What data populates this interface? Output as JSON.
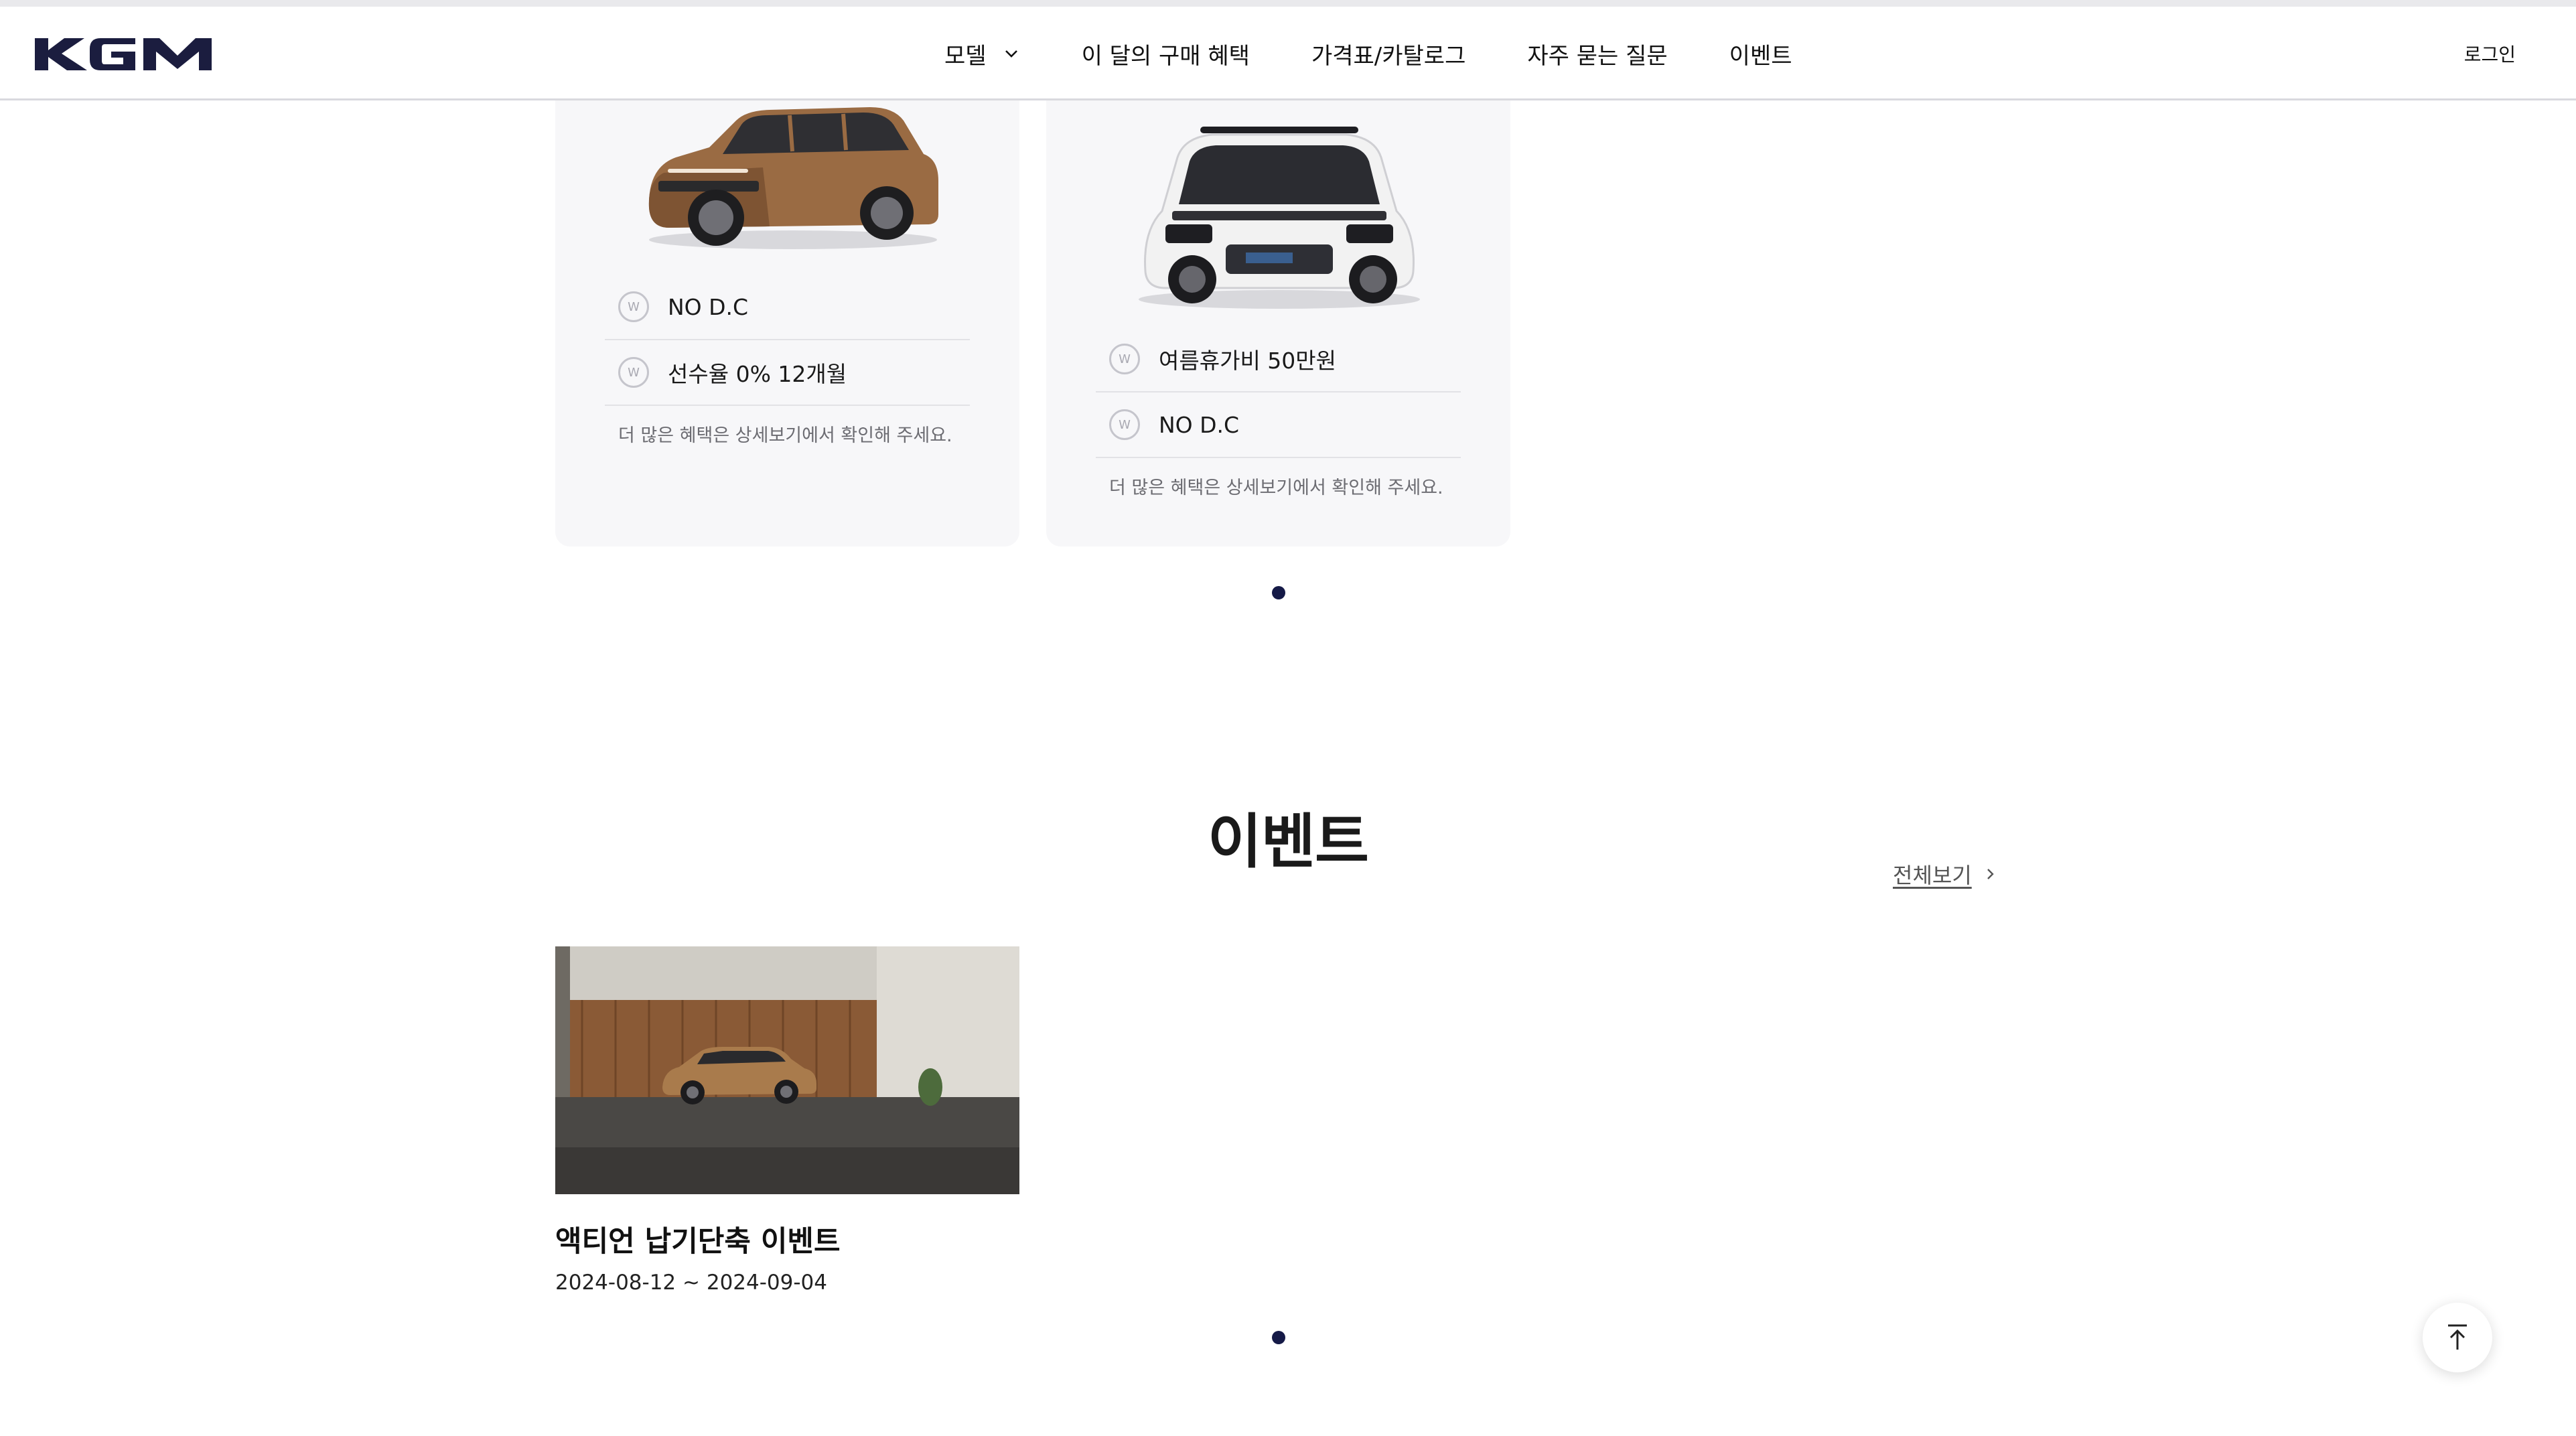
{
  "header": {
    "logo_text": "KGM",
    "nav": [
      {
        "label": "모델"
      },
      {
        "label": "이 달의 구매 혜택"
      },
      {
        "label": "가격표/카탈로그"
      },
      {
        "label": "자주 묻는 질문"
      },
      {
        "label": "이벤트"
      }
    ],
    "login_label": "로그인"
  },
  "models": [
    {
      "car_color": "bronze",
      "benefits": [
        "NO D.C",
        "선수율 0% 12개월"
      ],
      "note": "더 많은 혜택은 상세보기에서 확인해 주세요."
    },
    {
      "car_color": "white",
      "benefits": [
        "여름휴가비 50만원",
        "NO D.C"
      ],
      "note": "더 많은 혜택은 상세보기에서 확인해 주세요."
    }
  ],
  "events": {
    "title": "이벤트",
    "view_all": "전체보기",
    "items": [
      {
        "title": "액티언 납기단축 이벤트",
        "date": "2024-08-12 ~ 2024-09-04"
      }
    ]
  },
  "icons": {
    "won": "won-icon",
    "chevron": "chevron-down-icon",
    "arrow": "chevron-right-icon",
    "top": "scroll-top-icon"
  },
  "colors": {
    "brand": "#1b1d3f",
    "dot": "#151a47",
    "card_bg": "#f7f7f9"
  }
}
